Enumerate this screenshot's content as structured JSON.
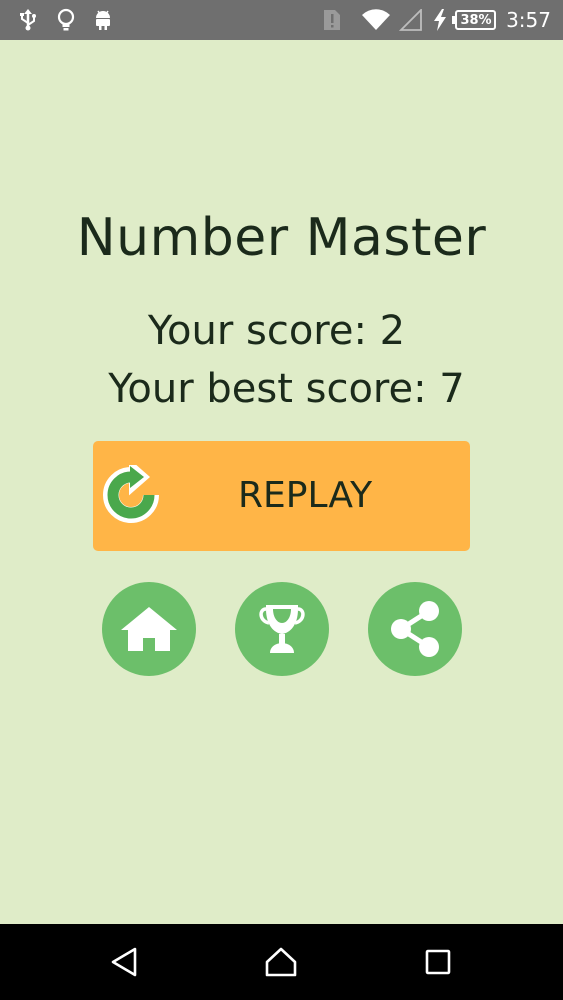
{
  "status_bar": {
    "time": "3:57",
    "battery_percent": "38%",
    "icons": [
      "usb-icon",
      "lightbulb-icon",
      "android-icon",
      "sim-alert-icon",
      "wifi-icon",
      "cellular-signal-icon",
      "charging-icon",
      "battery-icon"
    ]
  },
  "game": {
    "title": "Number Master",
    "score_text": "Your score: 2",
    "best_score_text": "Your best score: 7",
    "replay_label": "REPLAY"
  },
  "actions": [
    {
      "name": "home-button",
      "icon": "home-icon"
    },
    {
      "name": "leaderboard-button",
      "icon": "trophy-icon"
    },
    {
      "name": "share-button",
      "icon": "share-icon"
    }
  ],
  "nav": {
    "buttons": [
      "back",
      "home",
      "recents"
    ]
  },
  "colors": {
    "background": "#dfecc8",
    "status_bar": "#6f6f6f",
    "replay_button": "#ffb547",
    "round_button": "#6cbf6a",
    "text": "#1b2a1b",
    "replay_icon": "#4aa84c"
  }
}
